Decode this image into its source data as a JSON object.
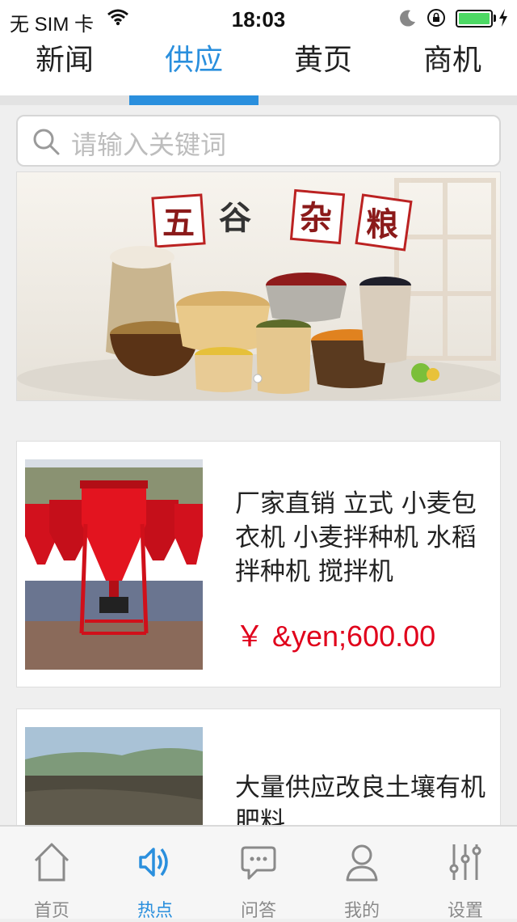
{
  "status_bar": {
    "carrier": "无 SIM 卡",
    "time": "18:03"
  },
  "tabs": [
    {
      "label": "新闻",
      "active": false
    },
    {
      "label": "供应",
      "active": true
    },
    {
      "label": "黄页",
      "active": false
    },
    {
      "label": "商机",
      "active": false
    }
  ],
  "search": {
    "placeholder": "请输入关键词",
    "icon": "search-icon"
  },
  "banner": {
    "title_chars": [
      "五",
      "谷",
      "杂",
      "粮"
    ],
    "page_count": 1,
    "current_page": 1
  },
  "products": [
    {
      "title": "厂家直销 立式 小麦包衣机 小麦拌种机 水稻拌种机 搅拌机",
      "price": "￥ &yen;600.00"
    },
    {
      "title": "大量供应改良土壤有机肥料",
      "price": ""
    }
  ],
  "bottom_nav": [
    {
      "label": "首页",
      "icon": "home-icon",
      "active": false
    },
    {
      "label": "热点",
      "icon": "speaker-icon",
      "active": true
    },
    {
      "label": "问答",
      "icon": "chat-icon",
      "active": false
    },
    {
      "label": "我的",
      "icon": "person-icon",
      "active": false
    },
    {
      "label": "设置",
      "icon": "sliders-icon",
      "active": false
    }
  ],
  "colors": {
    "accent": "#2a8fdd",
    "price": "#e0001b",
    "background": "#efefef"
  }
}
